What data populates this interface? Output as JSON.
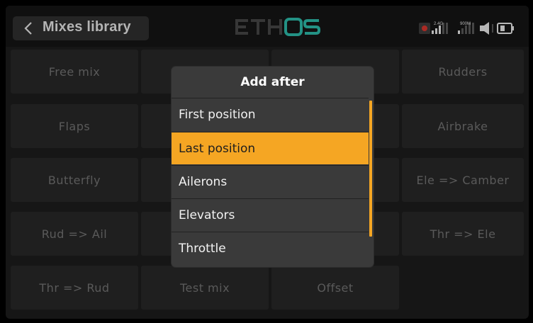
{
  "header": {
    "back_icon": "chevron-left-icon",
    "title": "Mixes library",
    "logo": "ETHOS",
    "status": {
      "receiver_signal_label": "2.4G",
      "telemetry_signal_label": "900M"
    }
  },
  "mixes": [
    "Free mix",
    "",
    "",
    "Rudders",
    "Flaps",
    "",
    "",
    "Airbrake",
    "Butterfly",
    "",
    "",
    "Ele => Camber",
    "Rud => Ail",
    "",
    "",
    "Thr => Ele",
    "Thr => Rud",
    "Test mix",
    "Offset",
    ""
  ],
  "dialog": {
    "title": "Add after",
    "items": [
      "First position",
      "Last position",
      "Ailerons",
      "Elevators",
      "Throttle"
    ],
    "selected_item": "Last position"
  },
  "colors": {
    "accent": "#f5a623",
    "logo_accent": "#2bb3a3"
  }
}
